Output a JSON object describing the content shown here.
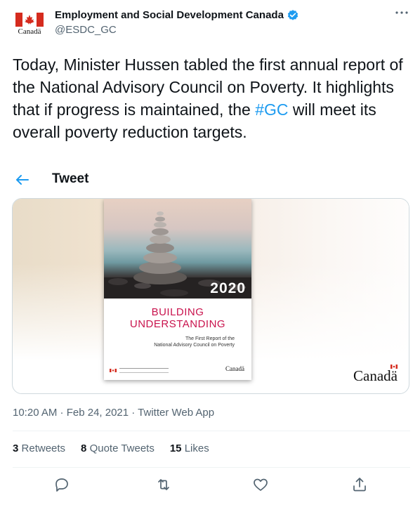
{
  "author": {
    "display_name": "Employment and Social Development Canada",
    "handle": "@ESDC_GC",
    "avatar_wordmark": "Canadä"
  },
  "tweet": {
    "text_before": "Today, Minister Hussen tabled the first annual report of the National Advisory Council on Poverty. It highlights that if progress is maintained, the ",
    "hashtag": "#GC",
    "text_after": " will meet its overall poverty reduction targets."
  },
  "nav": {
    "title": "Tweet"
  },
  "media": {
    "cover_year": "2020",
    "cover_title_line1": "BUILDING",
    "cover_title_line2": "UNDERSTANDING",
    "cover_subtitle_line1": "The First Report of the",
    "cover_subtitle_line2": "National Advisory Council on Poverty",
    "cover_footer_wordmark": "Canadä",
    "wordmark": "Canadä"
  },
  "meta": {
    "timestamp": "10:20 AM · Feb 24, 2021 · Twitter Web App"
  },
  "stats": {
    "retweets_count": "3",
    "retweets_label": "Retweets",
    "quotes_count": "8",
    "quotes_label": "Quote Tweets",
    "likes_count": "15",
    "likes_label": "Likes"
  },
  "colors": {
    "accent": "#1d9bf0",
    "text": "#0f1419",
    "muted": "#536471",
    "cover_title": "#c9134d",
    "flag_red": "#d52b1e"
  },
  "icons": [
    "verified-badge-icon",
    "more-icon",
    "back-arrow-icon",
    "reply-icon",
    "retweet-icon",
    "like-icon",
    "share-icon"
  ]
}
